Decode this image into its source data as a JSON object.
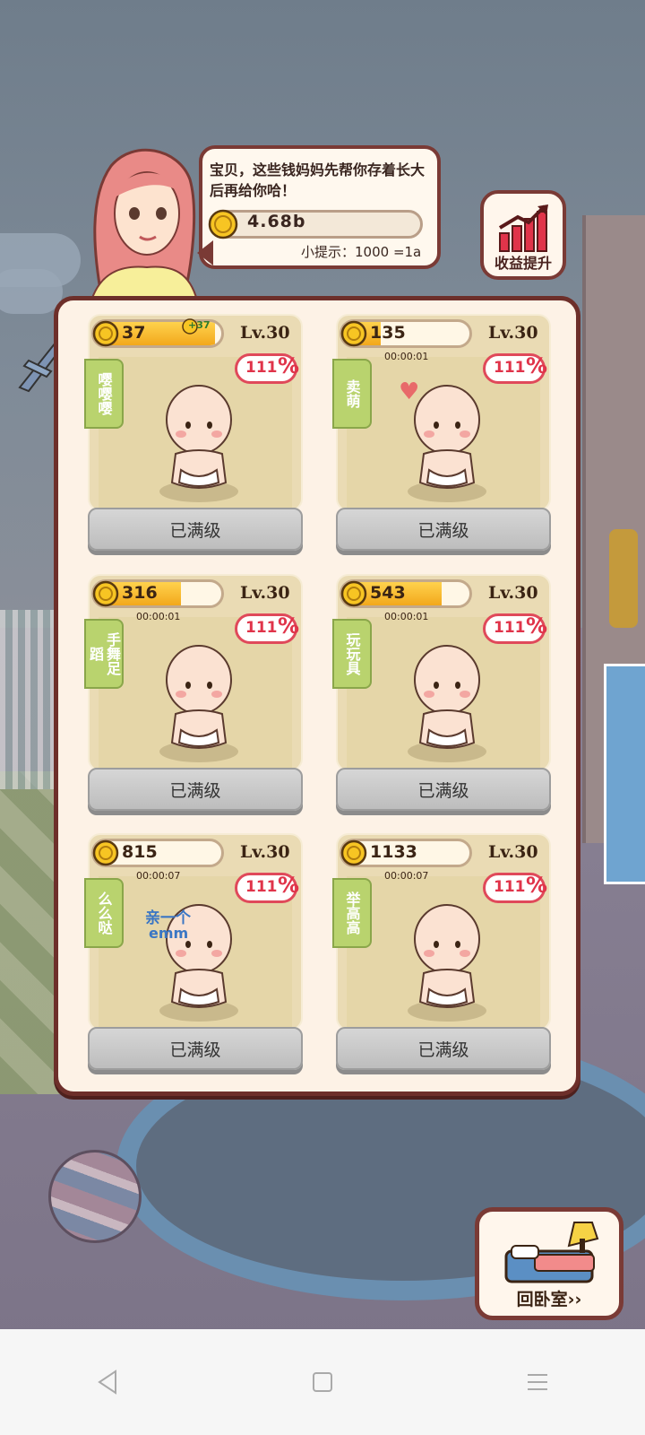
{
  "mom_dialog": {
    "message": "宝贝，这些钱妈妈先帮你存着长大后再给你哈！",
    "savings_value": "4.68b",
    "tip": "小提示：1000 =1a"
  },
  "boost_button": {
    "label": "收益提升"
  },
  "cards": [
    {
      "coins": "37",
      "coin_fill": 0.95,
      "level": "Lv.30",
      "tag": "嘤嘤嘤",
      "timer": "",
      "bonus": "111",
      "bonus_unit": "%",
      "button": "已满级",
      "plus": "+37"
    },
    {
      "coins": "135",
      "coin_fill": 0.3,
      "level": "Lv.30",
      "tag": "卖萌",
      "timer": "00:00:01",
      "bonus": "111",
      "bonus_unit": "%",
      "button": "已满级",
      "plus": ""
    },
    {
      "coins": "316",
      "coin_fill": 0.68,
      "level": "Lv.30",
      "tag": "手舞足蹈",
      "timer": "00:00:01",
      "bonus": "111",
      "bonus_unit": "%",
      "button": "已满级",
      "plus": ""
    },
    {
      "coins": "543",
      "coin_fill": 0.78,
      "level": "Lv.30",
      "tag": "玩玩具",
      "timer": "00:00:01",
      "bonus": "111",
      "bonus_unit": "%",
      "button": "已满级",
      "plus": ""
    },
    {
      "coins": "815",
      "coin_fill": 0.1,
      "level": "Lv.30",
      "tag": "么么哒",
      "timer": "00:00:07",
      "bonus": "111",
      "bonus_unit": "%",
      "button": "已满级",
      "plus": ""
    },
    {
      "coins": "1133",
      "coin_fill": 0.1,
      "level": "Lv.30",
      "tag": "举高高",
      "timer": "00:00:07",
      "bonus": "111",
      "bonus_unit": "%",
      "button": "已满级",
      "plus": ""
    }
  ],
  "kiss_caption": {
    "line1": "亲一个",
    "line2": "emm"
  },
  "bedroom_button": {
    "label": "回卧室››"
  },
  "colors": {
    "panel_border": "#6d2f2a",
    "coin_gold": "#f2a81c",
    "bonus_red": "#e0344a",
    "tag_green": "#b9d36e"
  },
  "icons": [
    "coin-icon",
    "growth-chart-icon",
    "bed-icon",
    "heart-icon",
    "back-icon",
    "home-icon",
    "menu-icon"
  ]
}
